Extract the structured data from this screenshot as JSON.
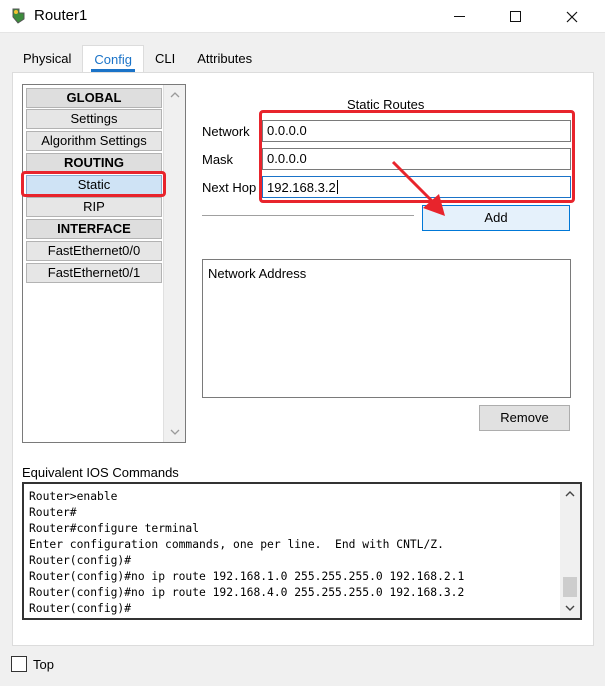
{
  "window": {
    "title": "Router1",
    "controls": [
      "minimize",
      "maximize",
      "close"
    ],
    "icon": "router-app-icon"
  },
  "tabs": [
    {
      "label": "Physical",
      "active": false
    },
    {
      "label": "Config",
      "active": true
    },
    {
      "label": "CLI",
      "active": false
    },
    {
      "label": "Attributes",
      "active": false
    }
  ],
  "nav": {
    "items": [
      {
        "label": "GLOBAL",
        "type": "header"
      },
      {
        "label": "Settings",
        "type": "item"
      },
      {
        "label": "Algorithm Settings",
        "type": "item"
      },
      {
        "label": "ROUTING",
        "type": "header"
      },
      {
        "label": "Static",
        "type": "item",
        "selected": true
      },
      {
        "label": "RIP",
        "type": "item"
      },
      {
        "label": "INTERFACE",
        "type": "header"
      },
      {
        "label": "FastEthernet0/0",
        "type": "item"
      },
      {
        "label": "FastEthernet0/1",
        "type": "item"
      }
    ]
  },
  "static_routes": {
    "title": "Static Routes",
    "network_label": "Network",
    "network_value": "0.0.0.0",
    "mask_label": "Mask",
    "mask_value": "0.0.0.0",
    "nexthop_label": "Next Hop",
    "nexthop_value": "192.168.3.2",
    "add_label": "Add",
    "list_header": "Network Address",
    "remove_label": "Remove"
  },
  "ios": {
    "label": "Equivalent IOS Commands",
    "lines": [
      "Router>enable",
      "Router#",
      "Router#configure terminal",
      "Enter configuration commands, one per line.  End with CNTL/Z.",
      "Router(config)#",
      "Router(config)#no ip route 192.168.1.0 255.255.255.0 192.168.2.1",
      "Router(config)#no ip route 192.168.4.0 255.255.255.0 192.168.3.2",
      "Router(config)#"
    ]
  },
  "footer": {
    "top_label": "Top",
    "top_checked": false
  },
  "colors": {
    "accent": "#1a73c8",
    "annotation": "#e8242c",
    "button_focus": "#0078d7"
  }
}
